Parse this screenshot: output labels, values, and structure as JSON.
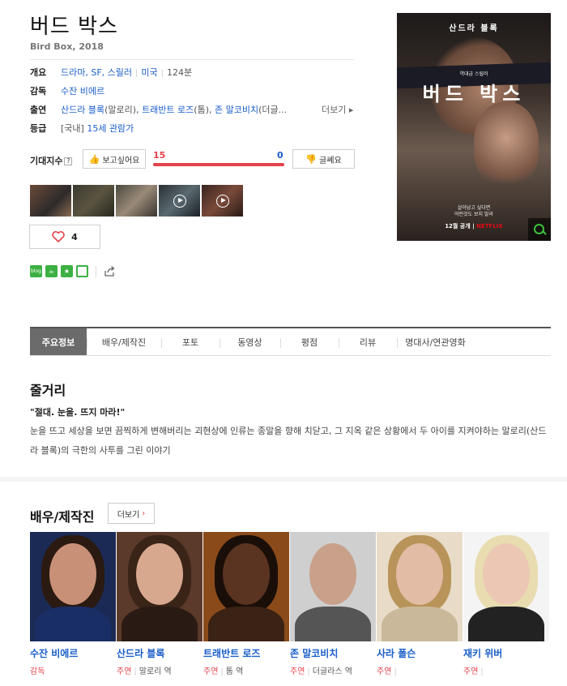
{
  "movie": {
    "title": "버드 박스",
    "original": "Bird Box, 2018"
  },
  "info": {
    "overview_label": "개요",
    "genre": "드라마, SF, 스릴러",
    "country": "미국",
    "runtime": "124분",
    "director_label": "감독",
    "director": "수잔 비에르",
    "cast_label": "출연",
    "cast_1": "산드라 블록",
    "cast_1_role": "(말로리),",
    "cast_2": "트래반트 로즈",
    "cast_2_role": "(톰),",
    "cast_3": "존 말코비치",
    "cast_3_role": "(더글...",
    "more_label": "더보기",
    "rating_label": "등급",
    "rating_prefix": "[국내]",
    "rating": "15세 관람가"
  },
  "expect": {
    "label": "기대지수",
    "want_label": "보고싶어요",
    "nowant_label": "글쎄요",
    "want_count": "15",
    "nowant_count": "0",
    "want_ratio": 1.0
  },
  "like_count": "4",
  "poster": {
    "top_text": "산드라 블록",
    "small_text": "역대급 스릴러",
    "title": "버드 박스",
    "tagline_1": "살아남고 싶다면",
    "tagline_2": "어떤것도 보지 말라",
    "release": "12월 공개",
    "brand": "NETFLIX"
  },
  "tabs": [
    "주요정보",
    "배우/제작진",
    "포토",
    "동영상",
    "평점",
    "리뷰",
    "명대사/연관영화"
  ],
  "synopsis": {
    "heading": "줄거리",
    "quote": "\"절대. 눈을. 뜨지 마라!\"",
    "text": "눈을 뜨고 세상을 보면 끔찍하게 변해버리는 괴현상에 인류는 종말을 향해 치닫고, 그 지옥 같은 상황에서 두 아이를 지켜야하는 말로리(산드라 블록)의 극한의 사투를 그린 이야기"
  },
  "cast_section": {
    "heading": "배우/제작진",
    "more_label": "더보기",
    "people": [
      {
        "name": "수잔 비에르",
        "role": "감독",
        "character": ""
      },
      {
        "name": "산드라 블록",
        "role": "주연",
        "character": "말로리 역"
      },
      {
        "name": "트래반트 로즈",
        "role": "주연",
        "character": "톰 역"
      },
      {
        "name": "존 말코비치",
        "role": "주연",
        "character": "더글라스 역"
      },
      {
        "name": "사라 폴슨",
        "role": "주연",
        "character": ""
      },
      {
        "name": "재키 위버",
        "role": "주연",
        "character": ""
      }
    ]
  },
  "colors": {
    "link": "#1a5ec9",
    "accent": "#e4424b",
    "tab_active": "#6b6b6b"
  }
}
